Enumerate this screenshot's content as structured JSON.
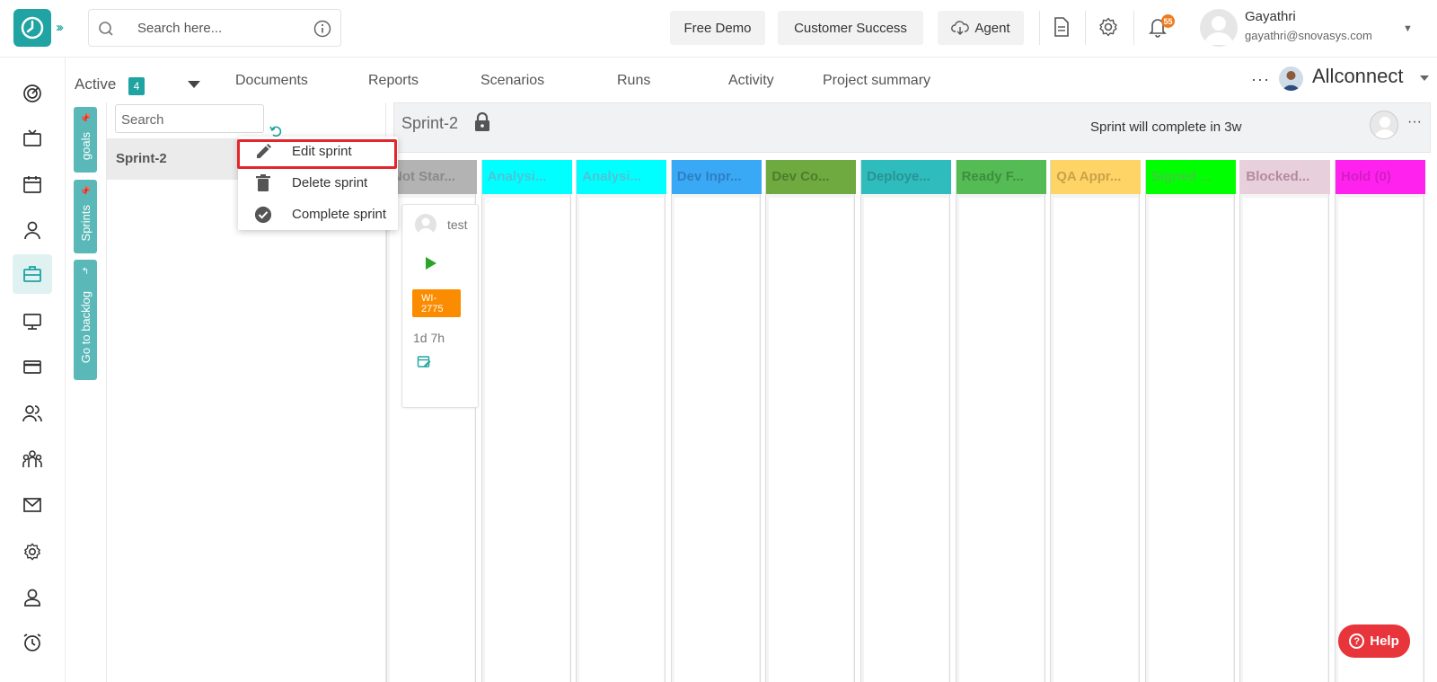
{
  "topbar": {
    "search_placeholder": "Search here...",
    "free_demo": "Free Demo",
    "customer_success": "Customer Success",
    "agent": "Agent",
    "notification_count": "55",
    "user_name": "Gayathri",
    "user_email": "gayathri@snovasys.com"
  },
  "subbar": {
    "active_label": "Active",
    "active_count": "4",
    "tabs": [
      "Documents",
      "Reports",
      "Scenarios",
      "Runs",
      "Activity",
      "Project summary"
    ],
    "project_name": "Allconnect",
    "more": "···"
  },
  "vertical_tabs": {
    "goals": "goals",
    "sprints": "Sprints",
    "backlog": "Go to backlog"
  },
  "sprint_panel": {
    "search_placeholder": "Search",
    "sprint_name": "Sprint-2"
  },
  "context_menu": {
    "items": [
      "Edit sprint",
      "Delete sprint",
      "Complete sprint"
    ]
  },
  "board": {
    "title": "Sprint-2",
    "status": "Sprint will complete in 3w",
    "more": "···",
    "columns": [
      {
        "label": "Not Star...",
        "color": "#b3b3b3",
        "text": "#8a8a8a"
      },
      {
        "label": "Analysi...",
        "color": "#00ffff",
        "text": "#4fc3d6"
      },
      {
        "label": "Analysi...",
        "color": "#00ffff",
        "text": "#4fc3d6"
      },
      {
        "label": "Dev Inpr...",
        "color": "#3aa9f5",
        "text": "#2e7fc2"
      },
      {
        "label": "Dev Co...",
        "color": "#6faa40",
        "text": "#4d7d2a"
      },
      {
        "label": "Deploye...",
        "color": "#2fbcbc",
        "text": "#2a9393"
      },
      {
        "label": "Ready F...",
        "color": "#55bb55",
        "text": "#3d8f3d"
      },
      {
        "label": "QA Appr...",
        "color": "#ffd466",
        "text": "#c9a24a"
      },
      {
        "label": "Signed ...",
        "color": "#00ff00",
        "text": "#3fcc3f"
      },
      {
        "label": "Blocked...",
        "color": "#e8cfdc",
        "text": "#b58aa0"
      },
      {
        "label": "Hold (0)",
        "color": "#ff22ee",
        "text": "#d11fc2"
      }
    ],
    "card": {
      "user": "test",
      "work_item": "WI-2775",
      "estimate": "1d 7h"
    }
  },
  "help": {
    "label": "Help"
  },
  "colors": {
    "brand": "#1fa3a3",
    "highlight": "#e3262a",
    "help": "#e8343b",
    "wi_badge": "#fb8c00"
  }
}
